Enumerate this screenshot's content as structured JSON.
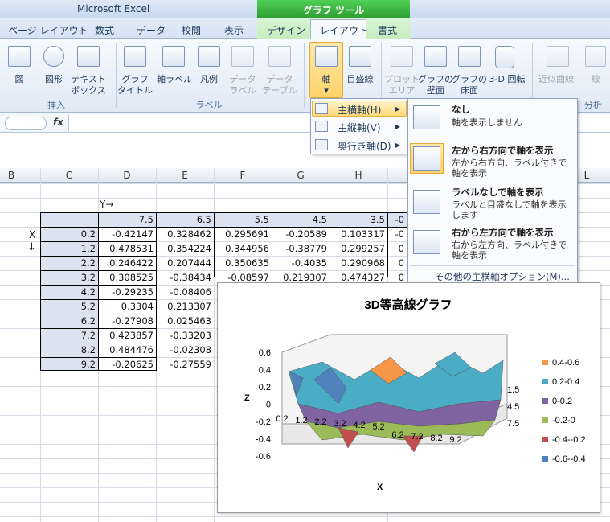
{
  "app": {
    "title": "Microsoft Excel"
  },
  "context_tab": {
    "title": "グラフ ツール"
  },
  "tabs": [
    "ページ レイアウト",
    "数式",
    "データ",
    "校閲",
    "表示",
    "デザイン",
    "レイアウト",
    "書式"
  ],
  "ribbon": {
    "insert_group": {
      "label": "挿入",
      "picture": "図",
      "shapes": "図形",
      "textbox": "テキスト",
      "textbox2": "ボックス"
    },
    "labels_group": {
      "label": "ラベル",
      "chart_title": "グラフ",
      "chart_title2": "タイトル",
      "axis_labels": "軸ラベル",
      "legend": "凡例",
      "data_labels": "データ",
      "data_labels2": "ラベル",
      "data_table": "データ",
      "data_table2": "テーブル"
    },
    "axes_group": {
      "axes": "軸",
      "gridlines": "目盛線"
    },
    "background_group": {
      "plot_area": "プロット",
      "plot_area2": "エリア",
      "wall": "グラフの",
      "wall2": "壁面",
      "floor": "グラフの",
      "floor2": "床面",
      "rotation": "3-D 回転"
    },
    "analysis_group": {
      "label": "分析",
      "trendline": "近似曲線",
      "lines": "線"
    }
  },
  "formula_bar": {
    "fx": "fx"
  },
  "columns": [
    "B",
    "C",
    "D",
    "E",
    "F",
    "G",
    "H",
    "L"
  ],
  "sheet": {
    "y_label": "Y→",
    "x_label": "X",
    "x_arrow": "↓",
    "y_headers": [
      "7.5",
      "6.5",
      "5.5",
      "4.5",
      "3.5",
      "-0"
    ],
    "rows": [
      {
        "x": "0.2",
        "vals": [
          "-0.42147",
          "0.328462",
          "0.295691",
          "-0.20589",
          "0.103317",
          "-0"
        ]
      },
      {
        "x": "1.2",
        "vals": [
          "0.478531",
          "0.354224",
          "0.344956",
          "-0.38779",
          "0.299257",
          "0"
        ]
      },
      {
        "x": "2.2",
        "vals": [
          "0.246422",
          "0.207444",
          "0.350635",
          "-0.4035",
          "0.290968",
          "0"
        ]
      },
      {
        "x": "3.2",
        "vals": [
          "0.308525",
          "-0.38434",
          "-0.08597",
          "0.219307",
          "0.474327",
          "0"
        ]
      },
      {
        "x": "4.2",
        "vals": [
          "-0.29235",
          "-0.08406",
          "",
          "",
          "",
          ""
        ]
      },
      {
        "x": "5.2",
        "vals": [
          "0.3304",
          "0.213307",
          "",
          "",
          "",
          ""
        ]
      },
      {
        "x": "6.2",
        "vals": [
          "-0.27908",
          "0.025463",
          "",
          "",
          "",
          ""
        ]
      },
      {
        "x": "7.2",
        "vals": [
          "0.423857",
          "-0.33203",
          "",
          "",
          "",
          ""
        ]
      },
      {
        "x": "8.2",
        "vals": [
          "0.484476",
          "-0.02308",
          "",
          "",
          "",
          ""
        ]
      },
      {
        "x": "9.2",
        "vals": [
          "-0.20625",
          "-0.27559",
          "",
          "",
          "",
          ""
        ]
      }
    ]
  },
  "menu_axes": {
    "items": [
      {
        "label": "主横軸(H)"
      },
      {
        "label": "主縦軸(V)"
      },
      {
        "label": "奥行き軸(D)"
      }
    ]
  },
  "submenu": {
    "items": [
      {
        "title": "なし",
        "desc": "軸を表示しません"
      },
      {
        "title": "左から右方向で軸を表示",
        "desc": "左から右方向、ラベル付きで軸を表示"
      },
      {
        "title": "ラベルなしで軸を表示",
        "desc": "ラベルと目盛なしで軸を表示します"
      },
      {
        "title": "右から左方向で軸を表示",
        "desc": "右から左方向、ラベル付きで軸を表示"
      }
    ],
    "more": "その他の主横軸オプション(M)..."
  },
  "chart": {
    "title": "3D等高線グラフ",
    "z_axis_label": "Z",
    "x_axis_label": "X",
    "z_ticks": [
      "0.6",
      "0.4",
      "0.2",
      "0",
      "-0.2",
      "-0.4",
      "-0.6"
    ],
    "x_ticks": [
      "0.2",
      "1.2",
      "2.2",
      "3.2",
      "4.2",
      "5.2",
      "6.2",
      "7.2",
      "8.2",
      "9.2"
    ],
    "y_ticks": [
      "1.5",
      "4.5",
      "7.5"
    ],
    "legend": [
      {
        "label": "0.4-0.6",
        "color": "#f79646"
      },
      {
        "label": "0.2-0.4",
        "color": "#4bacc6"
      },
      {
        "label": "0-0.2",
        "color": "#8064a2"
      },
      {
        "label": "-0.2-0",
        "color": "#9bbb59"
      },
      {
        "label": "-0.4--0.2",
        "color": "#c0504d"
      },
      {
        "label": "-0.6--0.4",
        "color": "#4f81bd"
      }
    ]
  }
}
